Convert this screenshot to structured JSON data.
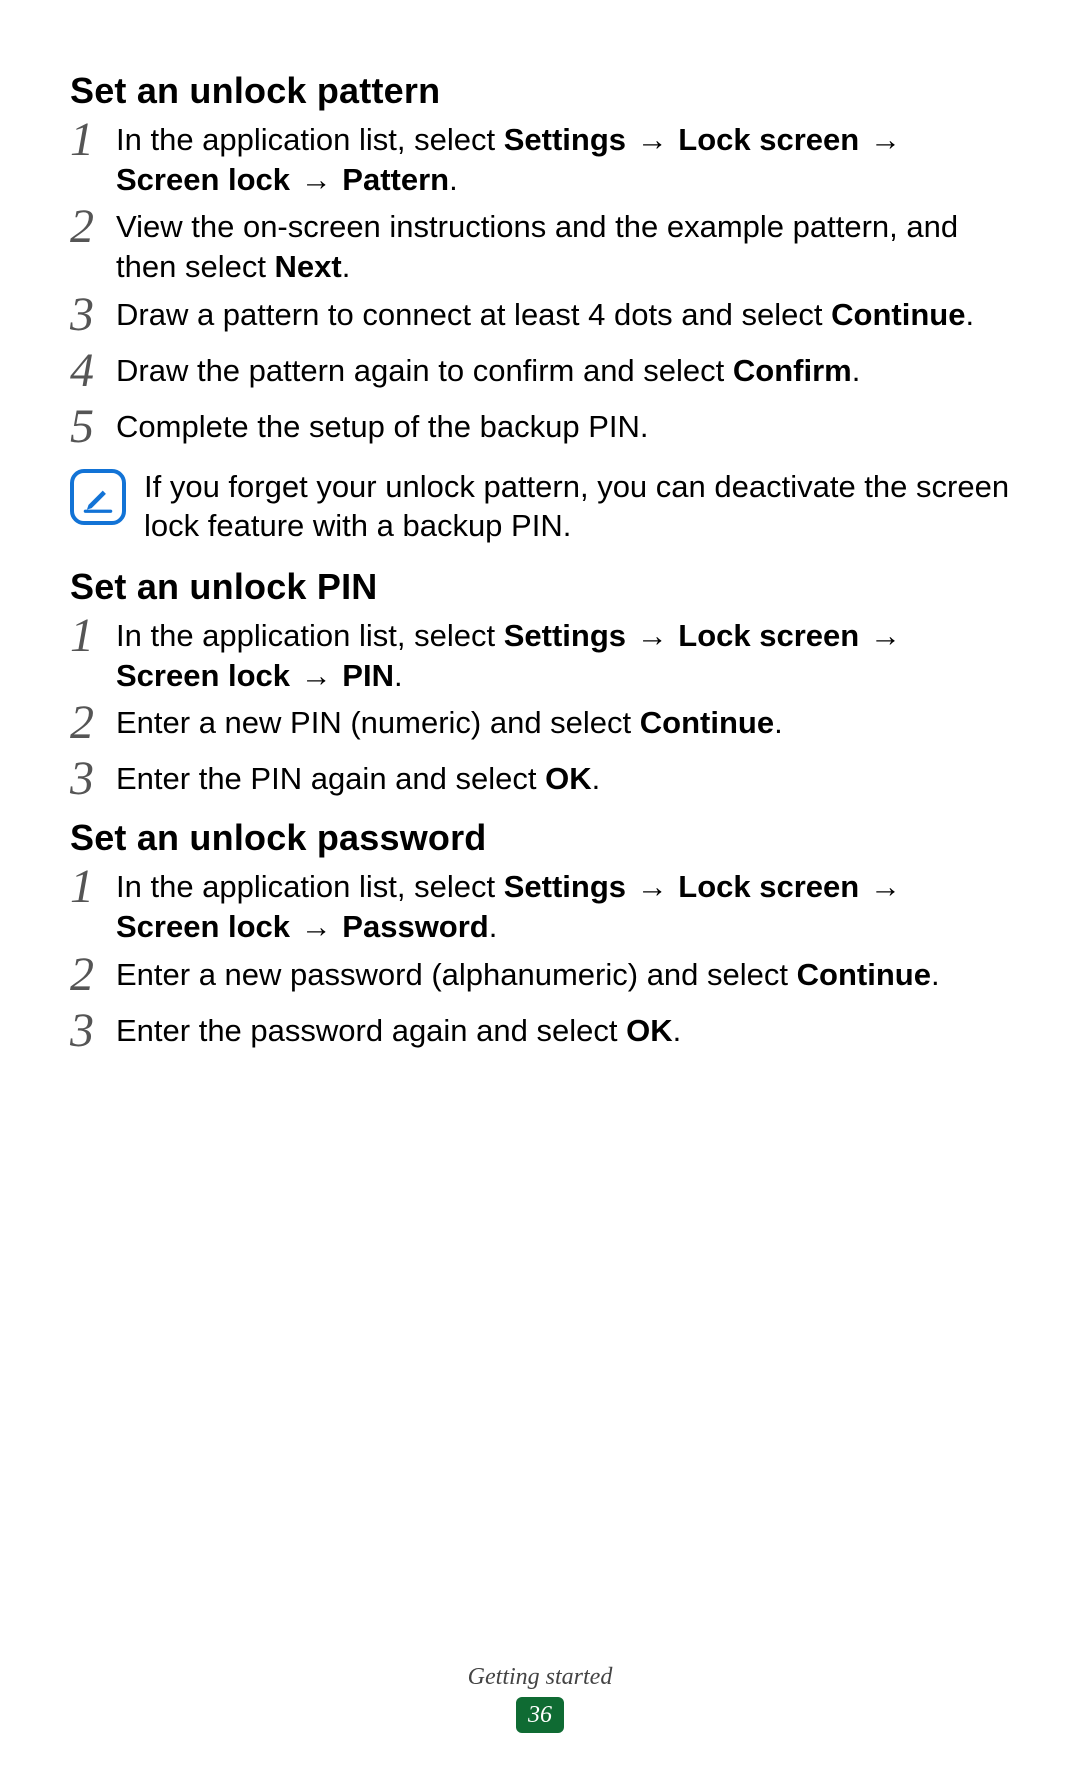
{
  "arrow": "→",
  "sections": [
    {
      "heading": "Set an unlock pattern",
      "steps": [
        {
          "n": "1",
          "parts": [
            "In the application list, select ",
            {
              "b": "Settings"
            },
            " ",
            {
              "arrow": true
            },
            " ",
            {
              "b": "Lock screen"
            },
            " ",
            {
              "arrow": true
            },
            " ",
            {
              "b": "Screen lock"
            },
            " ",
            {
              "arrow": true
            },
            " ",
            {
              "b": "Pattern"
            },
            "."
          ]
        },
        {
          "n": "2",
          "parts": [
            "View the on-screen instructions and the example pattern, and then select ",
            {
              "b": "Next"
            },
            "."
          ]
        },
        {
          "n": "3",
          "parts": [
            "Draw a pattern to connect at least 4 dots and select ",
            {
              "b": "Continue"
            },
            "."
          ]
        },
        {
          "n": "4",
          "parts": [
            "Draw the pattern again to confirm and select ",
            {
              "b": "Confirm"
            },
            "."
          ]
        },
        {
          "n": "5",
          "parts": [
            "Complete the setup of the backup PIN."
          ]
        }
      ],
      "note": "If you forget your unlock pattern, you can deactivate the screen lock feature with a backup PIN."
    },
    {
      "heading": "Set an unlock PIN",
      "steps": [
        {
          "n": "1",
          "parts": [
            "In the application list, select ",
            {
              "b": "Settings"
            },
            " ",
            {
              "arrow": true
            },
            " ",
            {
              "b": "Lock screen"
            },
            " ",
            {
              "arrow": true
            },
            " ",
            {
              "b": "Screen lock"
            },
            " ",
            {
              "arrow": true
            },
            " ",
            {
              "b": "PIN"
            },
            "."
          ]
        },
        {
          "n": "2",
          "parts": [
            "Enter a new PIN (numeric) and select ",
            {
              "b": "Continue"
            },
            "."
          ]
        },
        {
          "n": "3",
          "parts": [
            "Enter the PIN again and select ",
            {
              "b": "OK"
            },
            "."
          ]
        }
      ]
    },
    {
      "heading": "Set an unlock password",
      "steps": [
        {
          "n": "1",
          "parts": [
            "In the application list, select ",
            {
              "b": "Settings"
            },
            " ",
            {
              "arrow": true
            },
            " ",
            {
              "b": "Lock screen"
            },
            " ",
            {
              "arrow": true
            },
            " ",
            {
              "b": "Screen lock"
            },
            " ",
            {
              "arrow": true
            },
            " ",
            {
              "b": "Password"
            },
            "."
          ]
        },
        {
          "n": "2",
          "parts": [
            "Enter a new password (alphanumeric) and select ",
            {
              "b": "Continue"
            },
            "."
          ]
        },
        {
          "n": "3",
          "parts": [
            "Enter the password again and select ",
            {
              "b": "OK"
            },
            "."
          ]
        }
      ]
    }
  ],
  "footer": {
    "title": "Getting started",
    "page": "36"
  }
}
